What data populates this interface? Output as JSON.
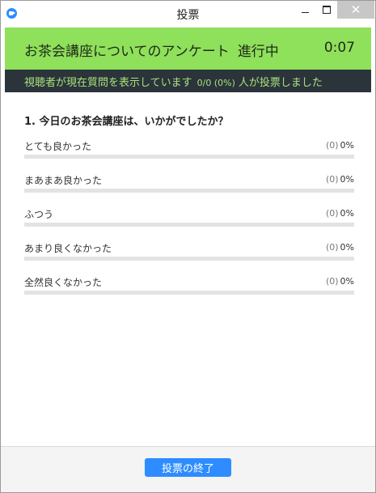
{
  "window": {
    "title": "投票",
    "icon": "zoom-app-icon",
    "controls": {
      "minimize": "minimize-icon",
      "maximize": "maximize-icon",
      "close": "close-icon"
    }
  },
  "poll": {
    "title": "お茶会講座についてのアンケート",
    "state": "進行中",
    "timer": "0:07",
    "header_color": "#8fe05a"
  },
  "status": {
    "prefix": "視聴者が現在質問を表示しています",
    "count": "0/0 (0%)",
    "suffix": "人が投票しました",
    "text_color": "#a9e27b"
  },
  "question": {
    "text": "1. 今日のお茶会講座は、いかがでしたか？",
    "options": [
      {
        "label": "とても良かった",
        "count": "(0)",
        "percent": "0%",
        "fraction": 0
      },
      {
        "label": "まあまあ良かった",
        "count": "(0)",
        "percent": "0%",
        "fraction": 0
      },
      {
        "label": "ふつう",
        "count": "(0)",
        "percent": "0%",
        "fraction": 0
      },
      {
        "label": "あまり良くなかった",
        "count": "(0)",
        "percent": "0%",
        "fraction": 0
      },
      {
        "label": "全然良くなかった",
        "count": "(0)",
        "percent": "0%",
        "fraction": 0
      }
    ]
  },
  "footer": {
    "end_button_label": "投票の終了",
    "accent": "#2d8cff"
  }
}
